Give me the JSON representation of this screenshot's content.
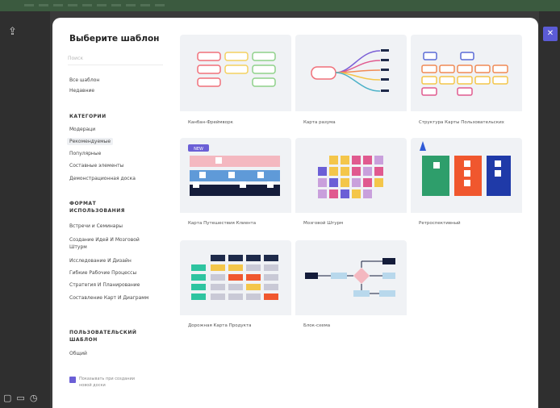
{
  "modal": {
    "title": "Выберите шаблон",
    "search_placeholder": "Поиск",
    "nav": [
      "Все шаблон",
      "Недавние"
    ],
    "categories_heading": "КАТЕГОРИИ",
    "categories": [
      "Модераци",
      "Рекомендуемые",
      "Популярные",
      "Составные элементы",
      "Демонстрационная доска"
    ],
    "selected_category": "Рекомендуемые",
    "format_heading": "ФОРМАТ ИСПОЛЬЗОВАНИЯ",
    "formats": [
      "Встречи и Семинары",
      "Создание Идей И Мозговой Штурм",
      "Исследование И Дизайн",
      "Гибкие Рабочие Процессы",
      "Стратегия И Планирование",
      "Составление Карт И Диаграмм"
    ],
    "custom_heading": "ПОЛЬЗОВАТЕЛЬСКИЙ ШАБЛОН",
    "custom_items": [
      "Общий"
    ],
    "checkbox_label": "Показывать при создании новой доски"
  },
  "templates": [
    {
      "label": "Канбан-Фреймворк"
    },
    {
      "label": "Карта разума"
    },
    {
      "label": "Структура Карты Пользовательских"
    },
    {
      "label": "Карта Путешествия Клиента",
      "badge": "NEW"
    },
    {
      "label": "Мозговой Штурм"
    },
    {
      "label": "Ретроспективный"
    },
    {
      "label": "Дорожная Карта Продукта"
    },
    {
      "label": "Блок-схема"
    }
  ],
  "toolbar": {
    "upload_icon": "upload-icon",
    "close_label": "✕"
  },
  "colors": {
    "accent": "#5b5bd6",
    "topbar": "#3b5a3f",
    "backdrop": "#3a3a3a"
  }
}
